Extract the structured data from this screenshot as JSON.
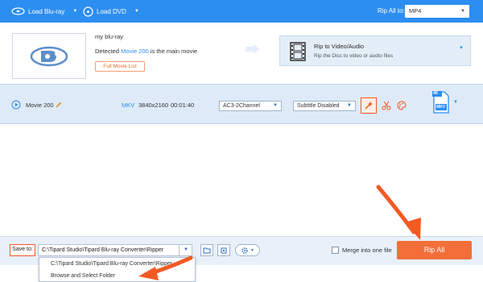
{
  "toolbar": {
    "load_bluray_label": "Load Blu-ray",
    "load_dvd_label": "Load DVD",
    "rip_all_to_label": "Rip All to:",
    "output_format": "MP4"
  },
  "disc": {
    "name": "my blu-ray",
    "detected_prefix": "Detected",
    "detected_movie": "Movie 200",
    "detected_suffix": "is the main movie",
    "full_movie_list_label": "Full Movie List"
  },
  "rip_panel": {
    "title": "Rip to Video/Audio",
    "subtitle": "Rip the Disc to video or audio files"
  },
  "movie_row": {
    "title": "Movie 200",
    "container": "MKV",
    "resolution": "3840x2160",
    "duration": "00:01:40",
    "audio_track": "AC3-2Channel",
    "subtitle": "Subtitle Disabled",
    "format_badge_top": "4K",
    "format_badge_bottom": "MKV"
  },
  "bottom_bar": {
    "save_to_label": "Save to:",
    "save_path": "C:\\Tipard Studio\\Tipard Blu-ray Converter\\Ripper",
    "merge_label": "Merge into one file",
    "rip_all_button": "Rip All"
  },
  "save_dropdown": {
    "options": [
      "C:\\Tipard Studio\\Tipard Blu-ray Converter\\Ripper",
      "Browse and Select Folder"
    ]
  },
  "colors": {
    "toolbar_bg": "#2c8ef0",
    "accent_orange": "#f26f3a",
    "highlight_border": "#f25a23",
    "row_bg": "#dfeaf8"
  }
}
